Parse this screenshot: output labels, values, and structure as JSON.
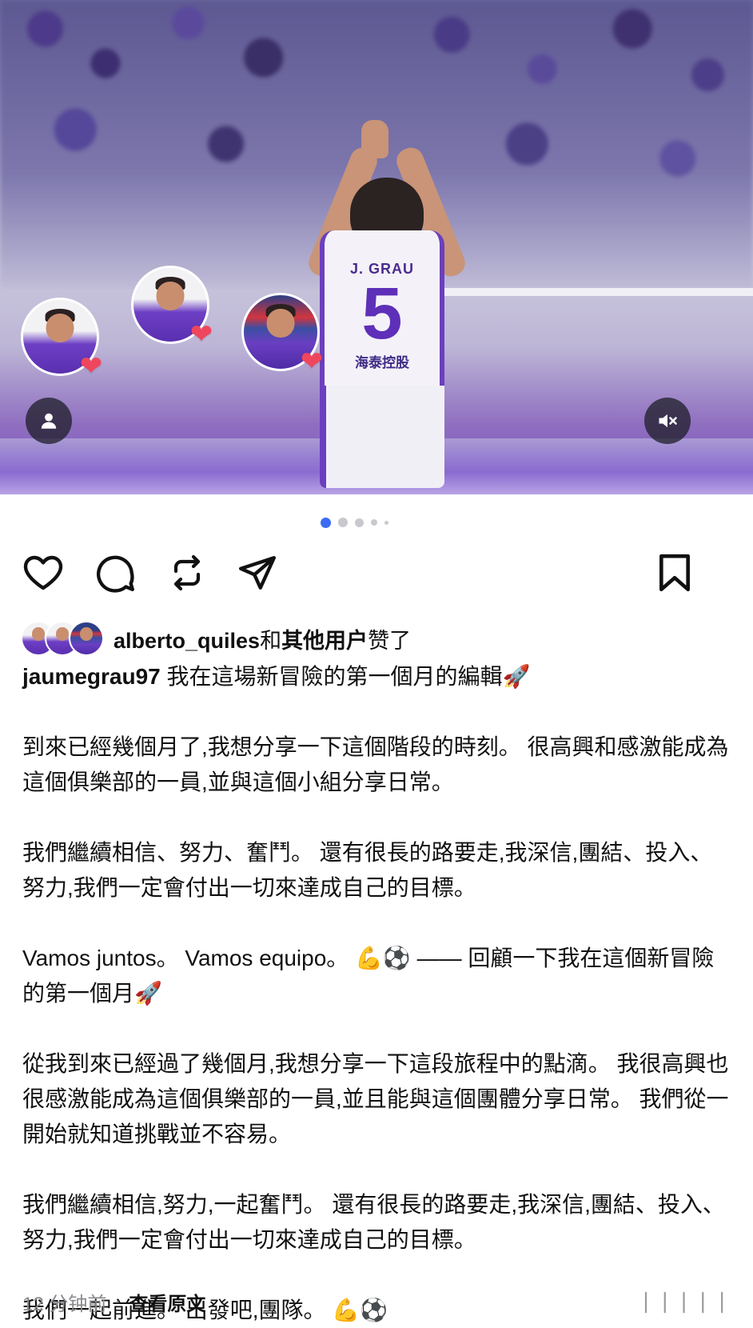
{
  "post_image": {
    "jersey_name": "J. GRAU",
    "jersey_number": "5",
    "jersey_sponsor": "海泰控股",
    "carousel": {
      "total": 5,
      "active": 1
    }
  },
  "icons": {
    "heart_reaction": "heart-icon",
    "user_tag": "user-icon",
    "mute": "speaker-mute-icon",
    "like": "heart-outline-icon",
    "comment": "comment-icon",
    "repost": "repost-icon",
    "share": "send-icon",
    "save": "bookmark-icon"
  },
  "likes": {
    "user": "alberto_quiles",
    "connector": "和",
    "others": "其他用户",
    "suffix": "赞了"
  },
  "caption": {
    "username": "jaumegrau97",
    "title": "我在這場新冒險的第一個月的編輯",
    "title_emoji": "🚀",
    "p1": "到來已經幾個月了,我想分享一下這個階段的時刻。 很高興和感激能成為這個俱樂部的一員,並與這個小組分享日常。",
    "p2": "我們繼續相信、努力、奮鬥。 還有很長的路要走,我深信,團結、投入、努力,我們一定會付出一切來達成自己的目標。",
    "p3_text": "Vamos juntos。 Vamos equipo。 ",
    "p3_emoji": "💪⚽",
    "p3_rest": " —— 回顧一下我在這個新冒險的第一個月",
    "p3_end_emoji": "🚀",
    "p4": "從我到來已經過了幾個月,我想分享一下這段旅程中的點滴。 我很高興也很感激能成為這個俱樂部的一員,並且能與這個團體分享日常。 我們從一開始就知道挑戰並不容易。",
    "p5": "我們繼續相信,努力,一起奮鬥。 還有很長的路要走,我深信,團結、投入、努力,我們一定會付出一切來達成自己的目標。",
    "p6_text": "我們一起前進。 出發吧,團隊。 ",
    "p6_emoji": "💪⚽"
  },
  "footer": {
    "time": "12 分钟前",
    "separator": "·",
    "view_original": "查看原文",
    "watermark": "❘❘❘❘❘"
  }
}
